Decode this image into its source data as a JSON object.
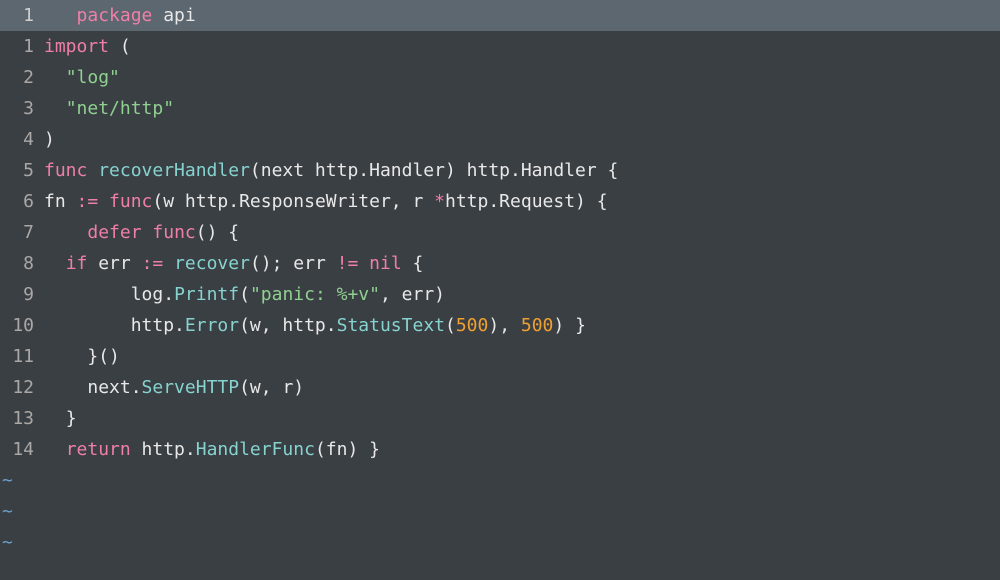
{
  "editor": {
    "cursor_line_index": 0,
    "lines": [
      {
        "n": "1",
        "indent": "   ",
        "tokens": [
          {
            "cls": "kw",
            "t": "package "
          },
          {
            "cls": "id",
            "t": "api"
          }
        ]
      },
      {
        "n": "1",
        "indent": "",
        "tokens": [
          {
            "cls": "kw",
            "t": "import "
          },
          {
            "cls": "id",
            "t": "("
          }
        ]
      },
      {
        "n": "2",
        "indent": "  ",
        "tokens": [
          {
            "cls": "str",
            "t": "\"log\""
          }
        ]
      },
      {
        "n": "3",
        "indent": "  ",
        "tokens": [
          {
            "cls": "str",
            "t": "\"net/http\""
          }
        ]
      },
      {
        "n": "4",
        "indent": "",
        "tokens": [
          {
            "cls": "id",
            "t": ")"
          }
        ]
      },
      {
        "n": "5",
        "indent": "",
        "tokens": [
          {
            "cls": "kw",
            "t": "func "
          },
          {
            "cls": "fn",
            "t": "recoverHandler"
          },
          {
            "cls": "id",
            "t": "(next http.Handler) http.Handler {"
          }
        ]
      },
      {
        "n": "6",
        "indent": "",
        "tokens": [
          {
            "cls": "id",
            "t": "fn "
          },
          {
            "cls": "kw",
            "t": ":= "
          },
          {
            "cls": "kw",
            "t": "func"
          },
          {
            "cls": "id",
            "t": "(w http.ResponseWriter, r "
          },
          {
            "cls": "kw",
            "t": "*"
          },
          {
            "cls": "id",
            "t": "http.Request) {"
          }
        ]
      },
      {
        "n": "7",
        "indent": "    ",
        "tokens": [
          {
            "cls": "kw",
            "t": "defer "
          },
          {
            "cls": "kw",
            "t": "func"
          },
          {
            "cls": "id",
            "t": "() {"
          }
        ]
      },
      {
        "n": "8",
        "indent": "  ",
        "tokens": [
          {
            "cls": "kw",
            "t": "if "
          },
          {
            "cls": "id",
            "t": "err "
          },
          {
            "cls": "kw",
            "t": ":= "
          },
          {
            "cls": "fn",
            "t": "recover"
          },
          {
            "cls": "id",
            "t": "(); err "
          },
          {
            "cls": "kw",
            "t": "!= "
          },
          {
            "cls": "kw",
            "t": "nil"
          },
          {
            "cls": "id",
            "t": " {"
          }
        ]
      },
      {
        "n": "9",
        "indent": "        ",
        "tokens": [
          {
            "cls": "id",
            "t": "log."
          },
          {
            "cls": "fn",
            "t": "Printf"
          },
          {
            "cls": "id",
            "t": "("
          },
          {
            "cls": "str",
            "t": "\"panic: %+v\""
          },
          {
            "cls": "id",
            "t": ", err)"
          }
        ]
      },
      {
        "n": "10",
        "indent": "        ",
        "tokens": [
          {
            "cls": "id",
            "t": "http."
          },
          {
            "cls": "fn",
            "t": "Error"
          },
          {
            "cls": "id",
            "t": "(w, http."
          },
          {
            "cls": "fn",
            "t": "StatusText"
          },
          {
            "cls": "id",
            "t": "("
          },
          {
            "cls": "num",
            "t": "500"
          },
          {
            "cls": "id",
            "t": "), "
          },
          {
            "cls": "num",
            "t": "500"
          },
          {
            "cls": "id",
            "t": ") }"
          }
        ]
      },
      {
        "n": "11",
        "indent": "    ",
        "tokens": [
          {
            "cls": "id",
            "t": "}()"
          }
        ]
      },
      {
        "n": "12",
        "indent": "    ",
        "tokens": [
          {
            "cls": "id",
            "t": "next."
          },
          {
            "cls": "fn",
            "t": "ServeHTTP"
          },
          {
            "cls": "id",
            "t": "(w, r)"
          }
        ]
      },
      {
        "n": "13",
        "indent": "  ",
        "tokens": [
          {
            "cls": "id",
            "t": "}"
          }
        ]
      },
      {
        "n": "14",
        "indent": "  ",
        "tokens": [
          {
            "cls": "kw",
            "t": "return "
          },
          {
            "cls": "id",
            "t": "http."
          },
          {
            "cls": "fn",
            "t": "HandlerFunc"
          },
          {
            "cls": "id",
            "t": "(fn) }"
          }
        ]
      }
    ],
    "tilde": "~"
  }
}
